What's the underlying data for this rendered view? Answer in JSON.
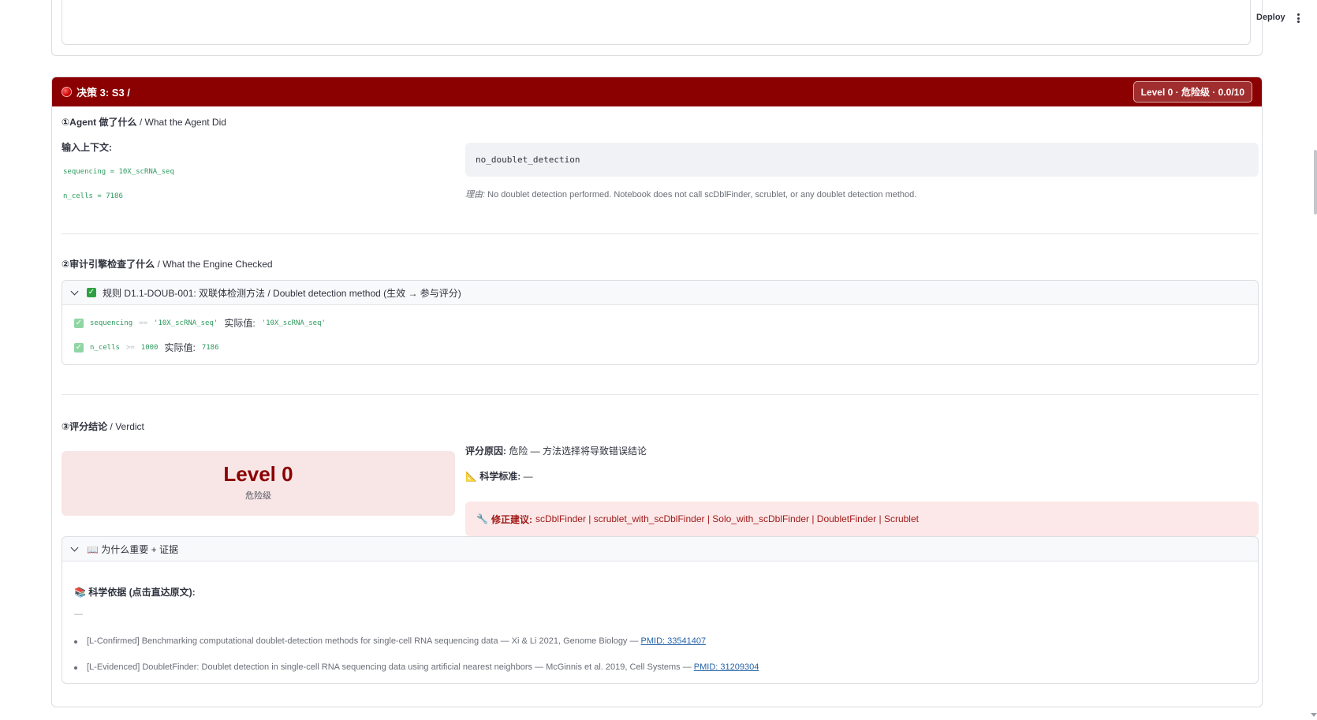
{
  "toolbar": {
    "deploy_label": "Deploy"
  },
  "decision": {
    "title": "决策 3: S3 /",
    "badge": "Level 0 · 危险级 · 0.0/10",
    "colors": {
      "header": "#8b0000",
      "ok": "#2ea043",
      "danger_bg": "#f8e5e6"
    }
  },
  "section1": {
    "num": "①",
    "title_cn": "Agent 做了什么",
    "title_en": " / What the Agent Did",
    "input_label": "输入上下文:",
    "inputs": [
      {
        "key": "sequencing",
        "op": " = ",
        "val": "10X_scRNA_seq"
      },
      {
        "key": "n_cells",
        "op": " = ",
        "val": "7186"
      }
    ],
    "action": "no_doublet_detection",
    "reason_prefix": "理由:",
    "reason": " No doublet detection performed. Notebook does not call scDblFinder, scrublet, or any doublet detection method."
  },
  "section2": {
    "num": "②",
    "title_cn": "审计引擎检查了什么",
    "title_en": " / What the Engine Checked",
    "rule_title": "规则 D1.1-DOUB-001: 双联体检测方法 / Doublet detection method (生效 → 参与评分)",
    "conditions": [
      {
        "field": "sequencing",
        "op": " == ",
        "expected": "'10X_scRNA_seq'",
        "actual_label": "实际值:",
        "actual": "'10X_scRNA_seq'"
      },
      {
        "field": "n_cells",
        "op": " >= ",
        "expected": "1000",
        "actual_label": "实际值:",
        "actual": "7186"
      }
    ]
  },
  "section3": {
    "num": "③",
    "title_cn": "评分结论",
    "title_en": " / Verdict",
    "level": "Level 0",
    "level_sub": "危险级",
    "reason_label": "评分原因:",
    "reason_text": " 危险 — 方法选择将导致错误结论",
    "standard_icon": "📐",
    "standard_label": "科学标准:",
    "standard_text": " —",
    "fix_icon": "🔧",
    "fix_label": "修正建议:",
    "fix_text": "scDblFinder | scrublet_with_scDblFinder | Solo_with_scDblFinder | DoubletFinder | Scrublet"
  },
  "evidence": {
    "expander_title": "📖 为什么重要 + 证据",
    "basis_icon": "📚",
    "basis_label": "科学依据 (点击直达原文):",
    "dash": "—",
    "items": [
      {
        "text": "[L-Confirmed] Benchmarking computational doublet-detection methods for single-cell RNA sequencing data — Xi & Li 2021, Genome Biology — ",
        "link": "PMID: 33541407"
      },
      {
        "text": "[L-Evidenced] DoubletFinder: Doublet detection in single-cell RNA sequencing data using artificial nearest neighbors — McGinnis et al. 2019, Cell Systems — ",
        "link": "PMID: 31209304"
      }
    ]
  }
}
